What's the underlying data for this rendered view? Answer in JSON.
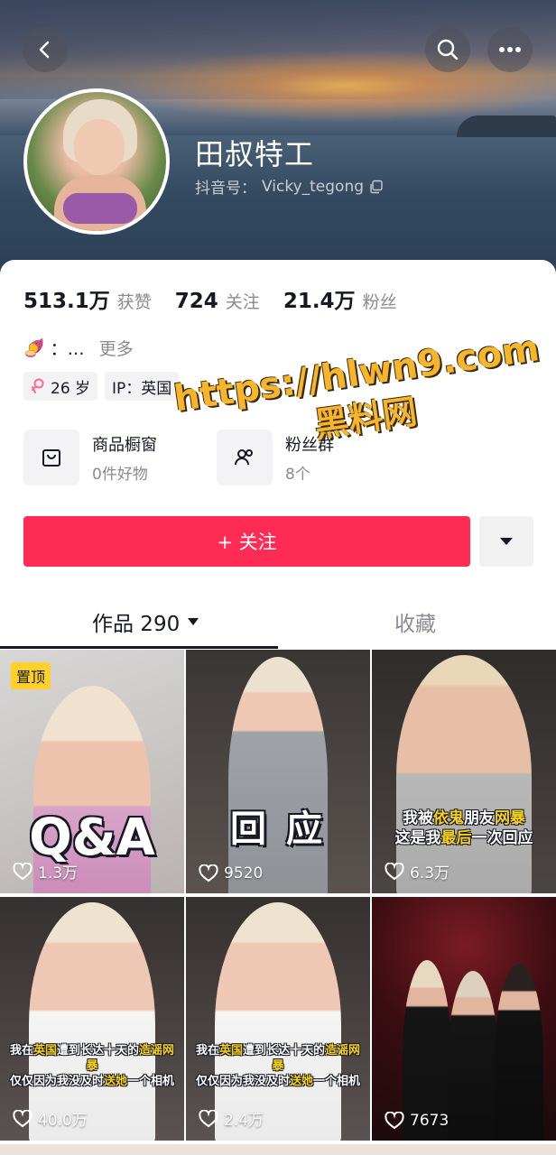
{
  "header": {
    "back_icon": "chevron-left-icon",
    "search_icon": "search-icon",
    "more_icon": "more-horizontal-icon"
  },
  "profile": {
    "name": "田叔特工",
    "handle_label": "抖音号：",
    "handle": "Vicky_tegong"
  },
  "stats": [
    {
      "value": "513.1万",
      "label": "获赞"
    },
    {
      "value": "724",
      "label": "关注"
    },
    {
      "value": "21.4万",
      "label": "粉丝"
    }
  ],
  "bio": {
    "emoji": "🍠",
    "text": "：…",
    "more": "更多"
  },
  "tags": {
    "age": "26 岁",
    "ip": "IP：英国"
  },
  "shortcuts": {
    "shop_title": "商品橱窗",
    "shop_sub": "0件好物",
    "group_title": "粉丝群",
    "group_sub": "8个"
  },
  "actions": {
    "follow": "+ 关注"
  },
  "tabs": {
    "works_label": "作品 290",
    "favorites_label": "收藏"
  },
  "videos": [
    {
      "likes": "1.3万",
      "pinned": "置顶",
      "overlay": "Q&A"
    },
    {
      "likes": "9520",
      "overlay": "回 应"
    },
    {
      "likes": "6.3万",
      "caption_1a": "我被",
      "caption_1b": "依鬼",
      "caption_1c": "朋友",
      "caption_1d": "网暴",
      "caption_2a": "这是我",
      "caption_2b": "最后",
      "caption_2c": "一次回应"
    },
    {
      "likes": "40.0万",
      "caption_1a": "我在",
      "caption_1b": "英国",
      "caption_1c": "遭到长达十天的",
      "caption_1d": "造谣网暴",
      "caption_2a": "仅仅因为我没及时",
      "caption_2b": "送她",
      "caption_2c": "一个相机"
    },
    {
      "likes": "2.4万",
      "caption_1a": "我在",
      "caption_1b": "英国",
      "caption_1c": "遭到长达十天的",
      "caption_1d": "造谣网暴",
      "caption_2a": "仅仅因为我没及时",
      "caption_2b": "送她",
      "caption_2c": "一个相机"
    },
    {
      "likes": "7673"
    }
  ],
  "watermark": {
    "line1": "https://hlwn9.com",
    "line2": "黑料网"
  },
  "colors": {
    "accent": "#fe2c55",
    "pin": "#fdd12a",
    "watermark": "#f6b52a"
  }
}
